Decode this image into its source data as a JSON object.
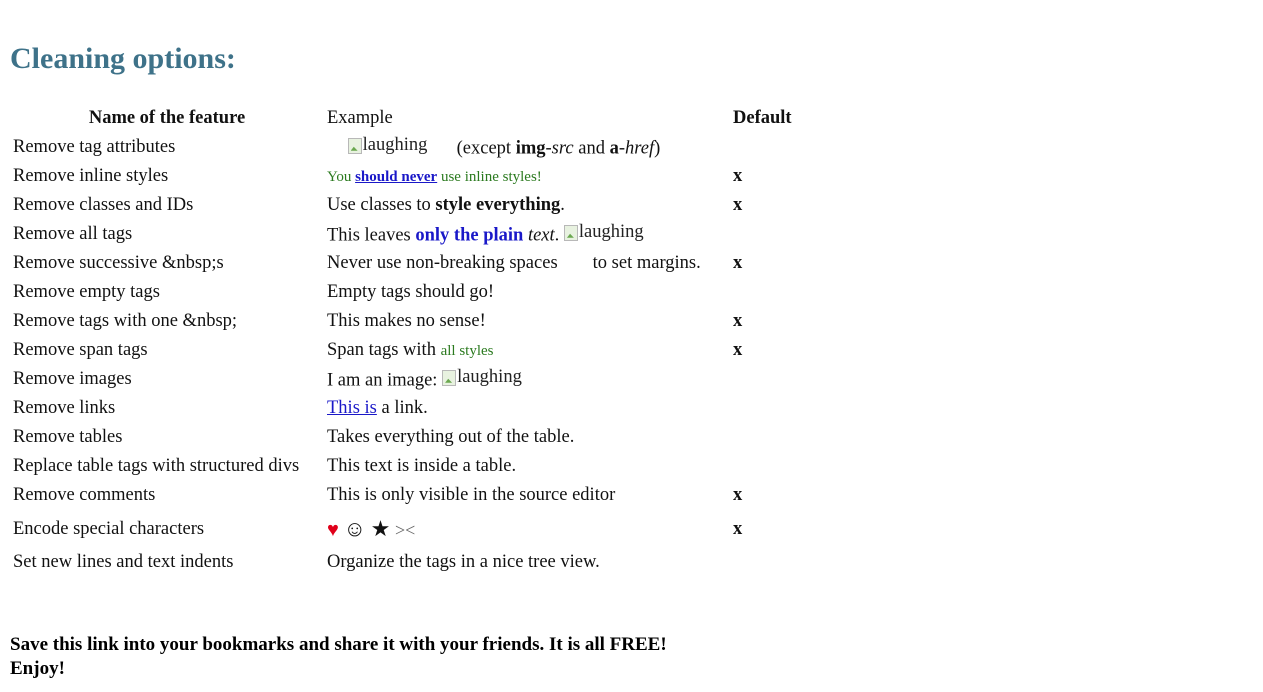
{
  "heading": "Cleaning options:",
  "table": {
    "headers": {
      "name": "Name of the feature",
      "example": "Example",
      "default": "Default"
    },
    "rows": [
      {
        "name": "Remove tag attributes",
        "example": {
          "img_alt": "laughing",
          "text1": "(except ",
          "b1": "img",
          "t2": "-",
          "i1": "src",
          "t3": " and ",
          "b2": "a",
          "t4": "-",
          "i2": "href",
          "t5": ")"
        },
        "default": ""
      },
      {
        "name": "Remove inline styles",
        "example": {
          "t1": "You ",
          "link": "should never",
          "t2": " use inline styles!"
        },
        "default": "x"
      },
      {
        "name": "Remove classes and IDs",
        "example": {
          "t1": "Use classes to ",
          "b1": "style everything",
          "t2": "."
        },
        "default": "x"
      },
      {
        "name": "Remove all tags",
        "example": {
          "t1": "This leaves ",
          "blue": "only the plain",
          "i1": "text",
          "t2": ".",
          "img_alt": "laughing"
        },
        "default": ""
      },
      {
        "name": "Remove successive &nbsp;s",
        "example": {
          "t1": "Never use non-breaking spaces",
          "t2": "to set margins."
        },
        "default": "x"
      },
      {
        "name": "Remove empty tags",
        "example": {
          "t1": "Empty tags should go!"
        },
        "default": ""
      },
      {
        "name": "Remove tags with one &nbsp;",
        "example": {
          "t1": "This makes no sense!"
        },
        "default": "x"
      },
      {
        "name": "Remove span tags",
        "example": {
          "t1": "Span tags with ",
          "green": "all styles"
        },
        "default": "x"
      },
      {
        "name": "Remove images",
        "example": {
          "t1": "I am an image: ",
          "img_alt": "laughing"
        },
        "default": ""
      },
      {
        "name": "Remove links",
        "example": {
          "link": "This is",
          "t1": " a link."
        },
        "default": ""
      },
      {
        "name": "Remove tables",
        "example": {
          "t1": "Takes everything out of the table."
        },
        "default": ""
      },
      {
        "name": "Replace table tags with structured divs",
        "example": {
          "t1": "This text is inside a table."
        },
        "default": ""
      },
      {
        "name": "Remove comments",
        "example": {
          "t1": "This is only visible in the source editor"
        },
        "default": "x"
      },
      {
        "name": "Encode special characters",
        "example": {
          "heart": "♥",
          "smile": "☺",
          "star": "★",
          "scissors": "><"
        },
        "default": "x"
      },
      {
        "name": "Set new lines and text indents",
        "example": {
          "t1": "Organize the tags in a nice tree view."
        },
        "default": ""
      }
    ]
  },
  "footer": {
    "line1": "Save this link into your bookmarks and share it with your friends. It is all FREE!",
    "line2": "Enjoy!"
  },
  "colors": {
    "heading": "#3e7289",
    "link": "#1a18c8",
    "green_text": "#2b7a1f",
    "heart": "#e0001a"
  }
}
